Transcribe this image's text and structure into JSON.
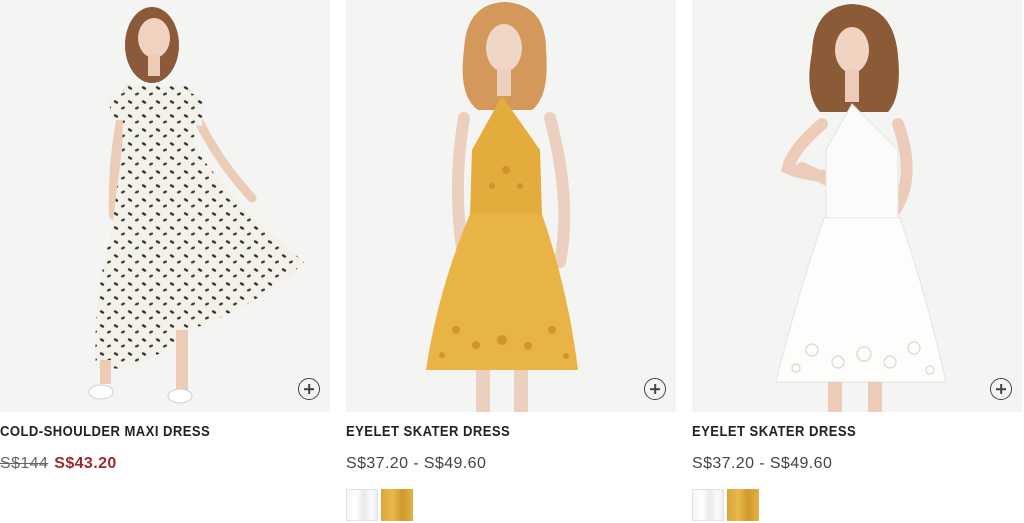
{
  "colors": {
    "sale_price": "#9b2b2b",
    "text": "#222222",
    "photo_background": "#f4f4f3",
    "swatch_white": "#f4f4f4",
    "swatch_yellow": "#e0ad40"
  },
  "products": [
    {
      "name": "COLD-SHOULDER MAXI DRESS",
      "price_original": "S$144",
      "price_sale": "S$43.20",
      "price_range": "",
      "quick_add_icon": "plus-circle-icon",
      "swatches": []
    },
    {
      "name": "EYELET SKATER DRESS",
      "price_original": "",
      "price_sale": "",
      "price_range": "S$37.20 - S$49.60",
      "quick_add_icon": "plus-circle-icon",
      "swatches": [
        "white",
        "yellow"
      ]
    },
    {
      "name": "EYELET SKATER DRESS",
      "price_original": "",
      "price_sale": "",
      "price_range": "S$37.20 - S$49.60",
      "quick_add_icon": "plus-circle-icon",
      "swatches": [
        "white",
        "yellow"
      ]
    }
  ]
}
